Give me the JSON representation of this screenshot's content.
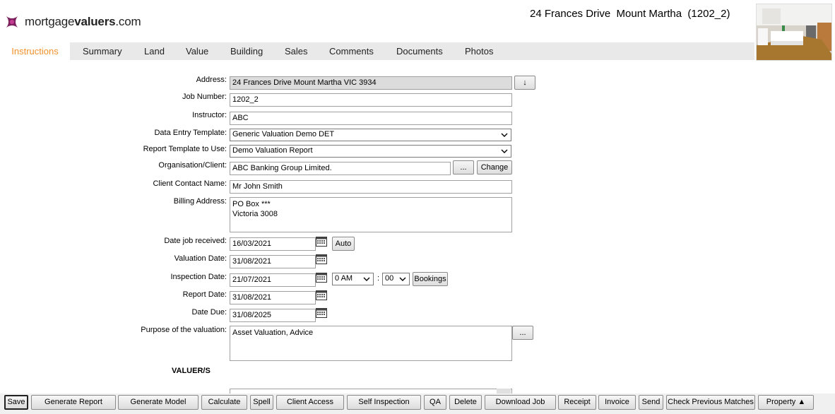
{
  "header": {
    "brand_regular": "mortgage",
    "brand_bold": "valuers",
    "brand_suffix": ".com",
    "property_title": "24 Frances Drive  Mount Martha  (1202_2)"
  },
  "tabs": [
    {
      "label": "Instructions",
      "active": true
    },
    {
      "label": "Summary"
    },
    {
      "label": "Land"
    },
    {
      "label": "Value"
    },
    {
      "label": "Building"
    },
    {
      "label": "Sales"
    },
    {
      "label": "Comments"
    },
    {
      "label": "Documents"
    },
    {
      "label": "Photos"
    }
  ],
  "form": {
    "address": {
      "label": "Address:",
      "value": "24 Frances Drive Mount Martha VIC 3934",
      "button": "↓"
    },
    "job_number": {
      "label": "Job Number:",
      "value": "1202_2"
    },
    "instructor": {
      "label": "Instructor:",
      "value": "ABC"
    },
    "data_entry_template": {
      "label": "Data Entry Template:",
      "value": "Generic Valuation Demo DET"
    },
    "report_template": {
      "label": "Report Template to Use:",
      "value": "Demo Valuation Report"
    },
    "organisation": {
      "label": "Organisation/Client:",
      "value": "ABC Banking Group Limited.",
      "browse": "...",
      "change": "Change"
    },
    "client_contact": {
      "label": "Client Contact Name:",
      "value": "Mr John Smith"
    },
    "billing_address": {
      "label": "Billing Address:",
      "value": "PO Box ***\nVictoria 3008"
    },
    "date_received": {
      "label": "Date job received:",
      "value": "16/03/2021",
      "auto": "Auto"
    },
    "valuation_date": {
      "label": "Valuation Date:",
      "value": "31/08/2021"
    },
    "inspection_date": {
      "label": "Inspection Date:",
      "value": "21/07/2021",
      "hour": "0 AM",
      "sep": ":",
      "minute": "00",
      "bookings": "Bookings"
    },
    "report_date": {
      "label": "Report Date:",
      "value": "31/08/2021"
    },
    "date_due": {
      "label": "Date Due:",
      "value": "31/08/2025"
    },
    "purpose": {
      "label": "Purpose of the valuation:",
      "value": "Asset Valuation, Advice",
      "browse": "..."
    },
    "valuers_section": "VALUER/S"
  },
  "toolbar": [
    "Save",
    "Generate Report",
    "Generate Model",
    "Calculate",
    "Spell",
    "Client Access",
    "Self Inspection",
    "QA",
    "Delete",
    "Download Job",
    "Receipt",
    "Invoice",
    "Send",
    "Check Previous Matches",
    "Property ▲"
  ],
  "colors": {
    "active_tab": "#f0922b",
    "tab_bar": "#e9e9e9",
    "logo": "#7a1f5c"
  }
}
